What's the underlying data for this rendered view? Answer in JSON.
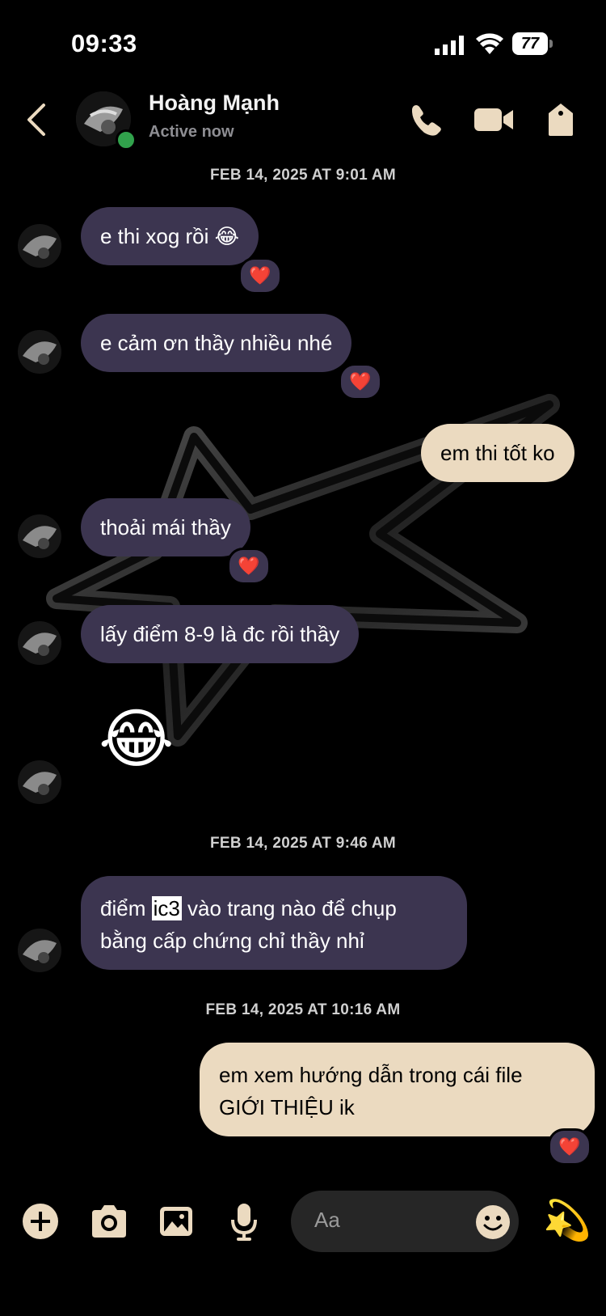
{
  "status_bar": {
    "time": "09:33",
    "battery": "77"
  },
  "header": {
    "contact_name": "Hoàng Mạnh",
    "status": "Active now",
    "icons": [
      "back-icon",
      "phone-icon",
      "video-icon",
      "tag-icon"
    ]
  },
  "colors": {
    "incoming_bubble": "#3c3550",
    "outgoing_bubble": "#ebdac0",
    "accent": "#ebdac0",
    "online": "#31a24c"
  },
  "timestamps": [
    "FEB 14, 2025 AT 9:01 AM",
    "FEB 14, 2025 AT 9:46 AM",
    "FEB 14, 2025 AT 10:16 AM"
  ],
  "messages": [
    {
      "from": "them",
      "text": "e thi xog rồi 😂",
      "reaction": "❤️"
    },
    {
      "from": "them",
      "text": "e cảm ơn thầy nhiều nhé",
      "reaction": "❤️"
    },
    {
      "from": "me",
      "text": "em thi tốt ko"
    },
    {
      "from": "them",
      "text": "thoải mái thầy",
      "reaction": "❤️"
    },
    {
      "from": "them",
      "text": "lấy điểm 8-9 là đc rồi thầy"
    },
    {
      "from": "them",
      "text": "😂"
    },
    {
      "from": "them",
      "line1_a": "điểm ",
      "line1_highlight": "ic3",
      "line1_b": " vào trang nào để chụp",
      "line2": "bằng cấp chứng chỉ thầy nhỉ"
    },
    {
      "from": "me",
      "line1": "em xem hướng dẫn trong cái file",
      "line2": "GIỚI THIỆU ik",
      "reaction": "❤️"
    }
  ],
  "composer": {
    "placeholder": "Aa",
    "like_emoji": "💫"
  }
}
